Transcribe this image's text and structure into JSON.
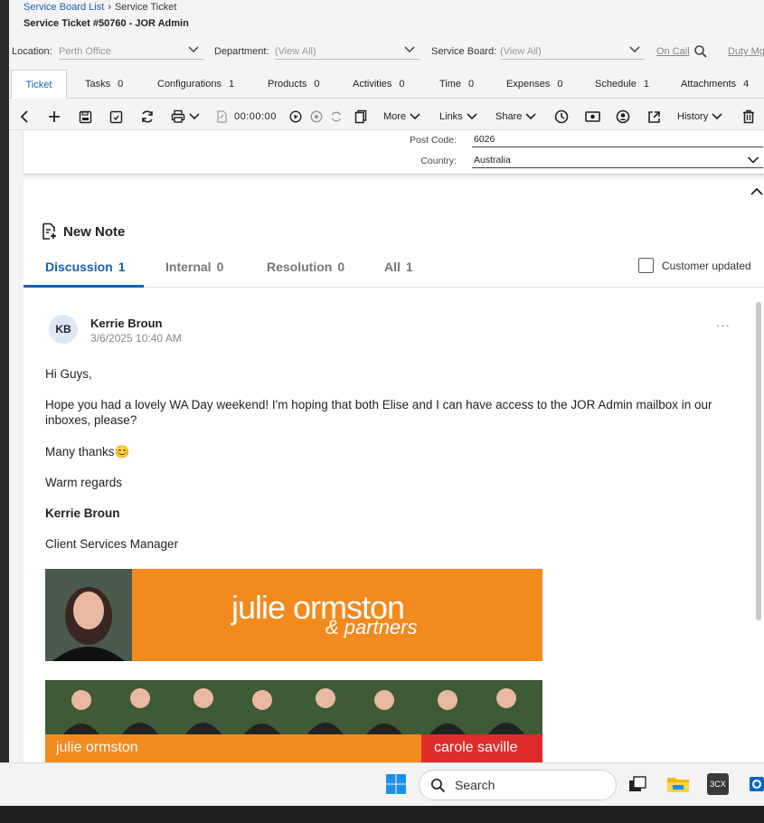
{
  "breadcrumb": {
    "link": "Service Board List",
    "current": "Service Ticket"
  },
  "page_title": "Service Ticket #50760 - JOR Admin",
  "filters": {
    "location_label": "Location:",
    "location_value": "Perth Office",
    "department_label": "Department:",
    "department_value": "(View All)",
    "board_label": "Service Board:",
    "board_value": "(View All)",
    "on_call": "On Call",
    "duty": "Duty Mg"
  },
  "tabs": [
    {
      "label": "Ticket",
      "count": ""
    },
    {
      "label": "Tasks",
      "count": "0"
    },
    {
      "label": "Configurations",
      "count": "1"
    },
    {
      "label": "Products",
      "count": "0"
    },
    {
      "label": "Activities",
      "count": "0"
    },
    {
      "label": "Time",
      "count": "0"
    },
    {
      "label": "Expenses",
      "count": "0"
    },
    {
      "label": "Schedule",
      "count": "1"
    },
    {
      "label": "Attachments",
      "count": "4"
    }
  ],
  "toolbar": {
    "timer": "00:00:00",
    "more": "More",
    "links": "Links",
    "share": "Share",
    "history": "History"
  },
  "address": {
    "postcode_label": "Post Code:",
    "postcode": "6026",
    "country_label": "Country:",
    "country": "Australia"
  },
  "notes": {
    "new_note": "New Note",
    "tabs": [
      {
        "label": "Discussion",
        "count": "1"
      },
      {
        "label": "Internal",
        "count": "0"
      },
      {
        "label": "Resolution",
        "count": "0"
      },
      {
        "label": "All",
        "count": "1"
      }
    ],
    "customer_updated": "Customer updated"
  },
  "message": {
    "initials": "KB",
    "author": "Kerrie Broun",
    "timestamp": "3/6/2025 10:40 AM",
    "greeting": "Hi Guys,",
    "body_line1": "Hope you had a lovely WA Day weekend! I'm hoping that both Elise and I can have access to the JOR Admin mailbox in our",
    "body_line2": "inboxes, please?",
    "thanks": "Many thanks😊",
    "regards": "Warm regards",
    "sig_name": "Kerrie Broun",
    "sig_title": "Client Services Manager",
    "banner_brand": "julie ormston",
    "banner_partners": "& partners",
    "banner2_left": "julie ormston",
    "banner2_right": "carole saville"
  },
  "taskbar": {
    "search": "Search"
  },
  "colors": {
    "accent": "#1a5fb4",
    "brand_orange": "#f28a1e",
    "brand_red": "#e02b2b"
  }
}
